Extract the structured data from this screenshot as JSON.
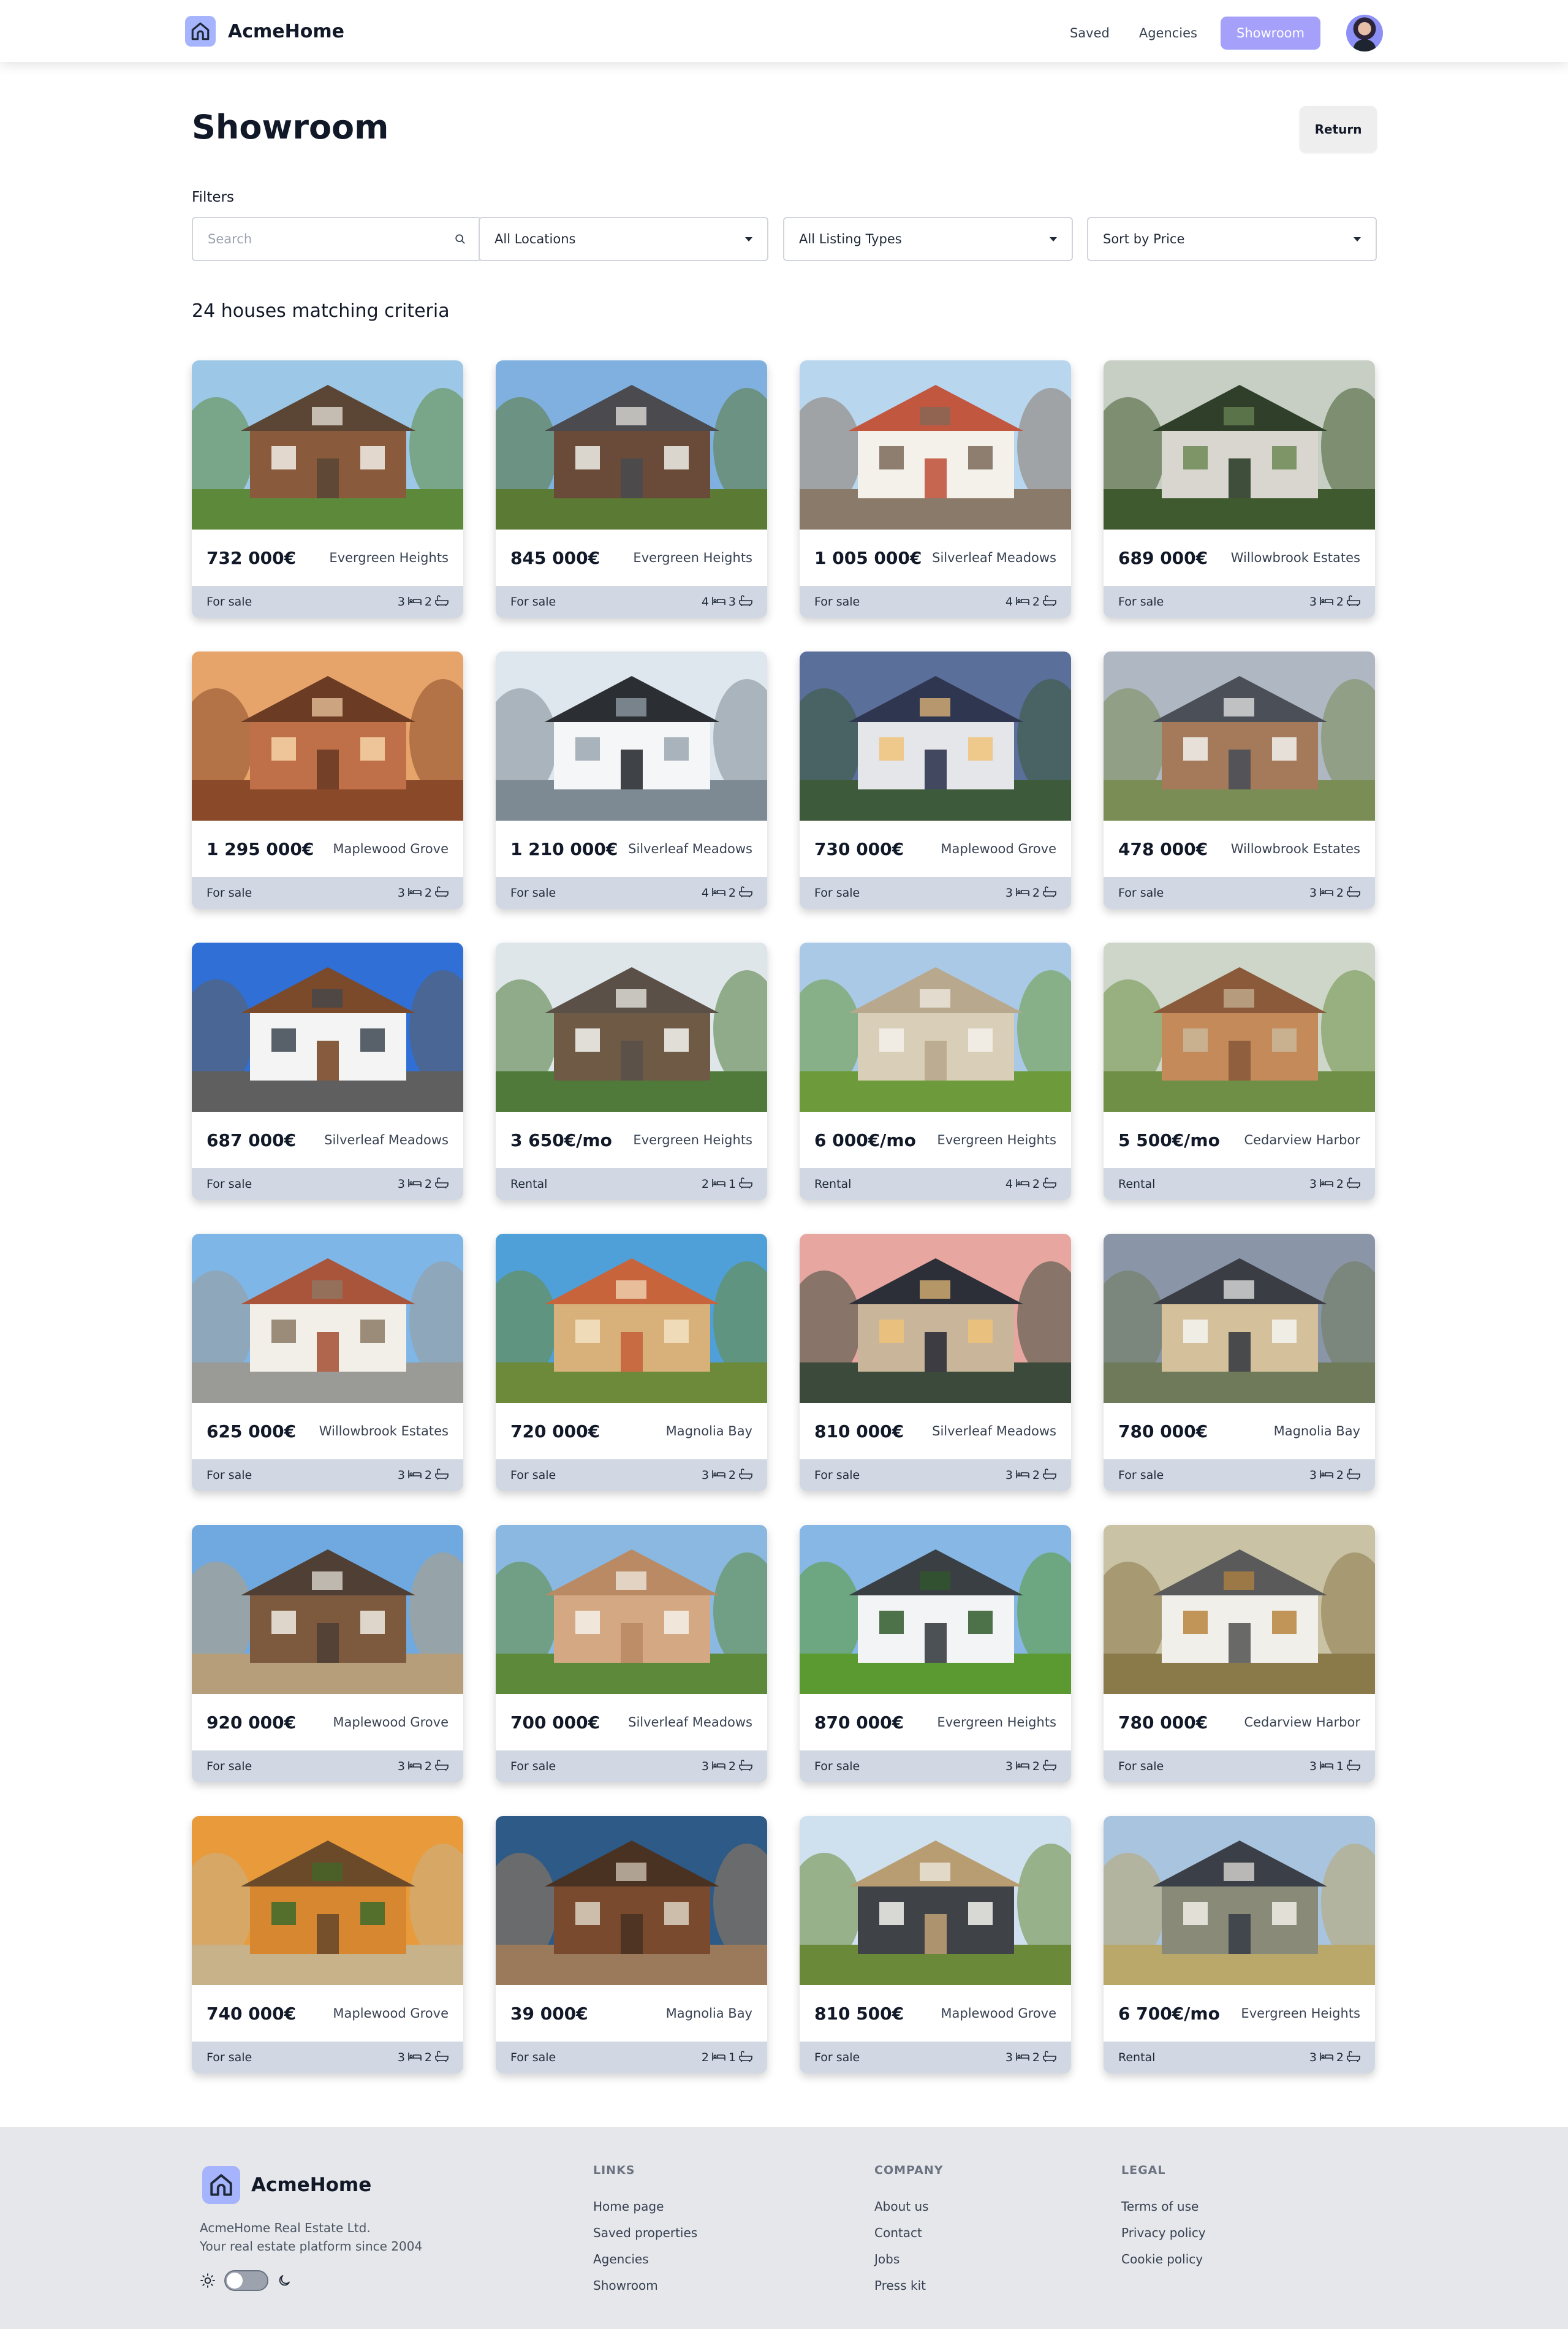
{
  "header": {
    "brand": "AcmeHome",
    "nav": [
      "Saved",
      "Agencies",
      "Showroom"
    ]
  },
  "page": {
    "title": "Showroom",
    "return_label": "Return"
  },
  "filters": {
    "label": "Filters",
    "search_placeholder": "Search",
    "location": "All Locations",
    "listing_type": "All Listing Types",
    "sort": "Sort by Price"
  },
  "results": {
    "count_text": "24 houses matching criteria"
  },
  "houses": [
    {
      "price": "732 000€",
      "location": "Evergreen Heights",
      "type": "For sale",
      "beds": "3",
      "baths": "2",
      "scene": "craftsman"
    },
    {
      "price": "845 000€",
      "location": "Evergreen Heights",
      "type": "For sale",
      "beds": "4",
      "baths": "3",
      "scene": "brick"
    },
    {
      "price": "1 005 000€",
      "location": "Silverleaf Meadows",
      "type": "For sale",
      "beds": "4",
      "baths": "2",
      "scene": "white"
    },
    {
      "price": "689 000€",
      "location": "Willowbrook Estates",
      "type": "For sale",
      "beds": "3",
      "baths": "2",
      "scene": "garden"
    },
    {
      "price": "1 295 000€",
      "location": "Maplewood Grove",
      "type": "For sale",
      "beds": "3",
      "baths": "2",
      "scene": "sunset"
    },
    {
      "price": "1 210 000€",
      "location": "Silverleaf Meadows",
      "type": "For sale",
      "beds": "4",
      "baths": "2",
      "scene": "modern"
    },
    {
      "price": "730 000€",
      "location": "Maplewood Grove",
      "type": "For sale",
      "beds": "3",
      "baths": "2",
      "scene": "dusk"
    },
    {
      "price": "478 000€",
      "location": "Willowbrook Estates",
      "type": "For sale",
      "beds": "3",
      "baths": "2",
      "scene": "stone"
    },
    {
      "price": "687 000€",
      "location": "Silverleaf Meadows",
      "type": "For sale",
      "beds": "3",
      "baths": "2",
      "scene": "glass"
    },
    {
      "price": "3 650€/mo",
      "location": "Evergreen Heights",
      "type": "Rental",
      "beds": "2",
      "baths": "1",
      "scene": "cabin"
    },
    {
      "price": "6 000€/mo",
      "location": "Evergreen Heights",
      "type": "Rental",
      "beds": "4",
      "baths": "2",
      "scene": "ranch"
    },
    {
      "price": "5 500€/mo",
      "location": "Cedarview Harbor",
      "type": "Rental",
      "beds": "3",
      "baths": "2",
      "scene": "estate"
    },
    {
      "price": "625 000€",
      "location": "Willowbrook Estates",
      "type": "For sale",
      "beds": "3",
      "baths": "2",
      "scene": "villa"
    },
    {
      "price": "720 000€",
      "location": "Magnolia Bay",
      "type": "For sale",
      "beds": "3",
      "baths": "2",
      "scene": "redroof"
    },
    {
      "price": "810 000€",
      "location": "Silverleaf Meadows",
      "type": "For sale",
      "beds": "3",
      "baths": "2",
      "scene": "twilight"
    },
    {
      "price": "780 000€",
      "location": "Magnolia Bay",
      "type": "For sale",
      "beds": "3",
      "baths": "2",
      "scene": "tan"
    },
    {
      "price": "920 000€",
      "location": "Maplewood Grove",
      "type": "For sale",
      "beds": "3",
      "baths": "2",
      "scene": "brown"
    },
    {
      "price": "700 000€",
      "location": "Silverleaf Meadows",
      "type": "For sale",
      "beds": "3",
      "baths": "2",
      "scene": "bungalow"
    },
    {
      "price": "870 000€",
      "location": "Evergreen Heights",
      "type": "For sale",
      "beds": "3",
      "baths": "2",
      "scene": "lawn"
    },
    {
      "price": "780 000€",
      "location": "Cedarview Harbor",
      "type": "For sale",
      "beds": "3",
      "baths": "1",
      "scene": "cottage"
    },
    {
      "price": "740 000€",
      "location": "Maplewood Grove",
      "type": "For sale",
      "beds": "3",
      "baths": "2",
      "scene": "orange"
    },
    {
      "price": "39 000€",
      "location": "Magnolia Bay",
      "type": "For sale",
      "beds": "2",
      "baths": "1",
      "scene": "shack"
    },
    {
      "price": "810 500€",
      "location": "Maplewood Grove",
      "type": "For sale",
      "beds": "3",
      "baths": "2",
      "scene": "thatch"
    },
    {
      "price": "6 700€/mo",
      "location": "Evergreen Heights",
      "type": "Rental",
      "beds": "3",
      "baths": "2",
      "scene": "suburban"
    }
  ],
  "footer": {
    "brand": "AcmeHome",
    "company_name": "AcmeHome Real Estate Ltd.",
    "tagline": "Your real estate platform since 2004",
    "columns": [
      {
        "title": "LINKS",
        "links": [
          "Home page",
          "Saved properties",
          "Agencies",
          "Showroom"
        ]
      },
      {
        "title": "COMPANY",
        "links": [
          "About us",
          "Contact",
          "Jobs",
          "Press kit"
        ]
      },
      {
        "title": "LEGAL",
        "links": [
          "Terms of use",
          "Privacy policy",
          "Cookie policy"
        ]
      }
    ]
  },
  "colors": {
    "accent": "#a5a0fa",
    "logo_bg": "#a5b4fc",
    "card_footer": "#d1d8e3",
    "footer_bg": "#e5e7eb"
  },
  "icons": [
    "home-logo-icon",
    "search-icon",
    "chevron-down-icon",
    "bed-icon",
    "bath-icon",
    "sun-icon",
    "moon-icon"
  ]
}
